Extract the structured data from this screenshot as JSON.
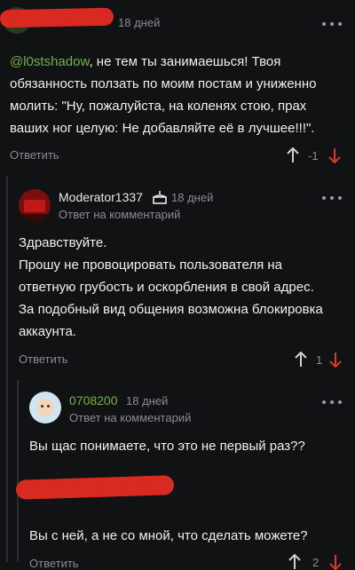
{
  "comments": [
    {
      "author": "",
      "time": "18 дней",
      "mention": "@l0stshadow",
      "text_rest": ", не тем ты занимаешься! Твоя обязанность ползать по моим постам и униженно молить: \"Ну, пожалуйста, на коленях стою, прах ваших ног целую: Не добавляйте её в лучшее!!!\".",
      "reply_label": "Ответить",
      "rating": "-1",
      "colors": {
        "down_active": "#e0352b"
      }
    },
    {
      "author": "Moderator1337",
      "time": "18 дней",
      "reply_to": "Ответ на комментарий",
      "lines": [
        "Здравствуйте.",
        "Прошу не провоцировать пользователя на ответную грубость и оскорбления в свой адрес.",
        "За подобный вид общения возможна блокировка аккаунта."
      ],
      "reply_label": "Ответить",
      "rating": "1",
      "badge_icon": "cake-icon"
    },
    {
      "author": "0708200",
      "time": "18 дней",
      "reply_to": "Ответ на комментарий",
      "text": "Вы щас понимаете, что это не первый раз??",
      "author_color": "#72b33d"
    },
    {
      "text": "Вы с ней, а не со мной, что сделать можете?",
      "reply_label": "Ответить",
      "rating": "2"
    }
  ],
  "colors": {
    "accent_green": "#72b33d",
    "redaction_red": "#d92a21",
    "background": "#111214"
  }
}
